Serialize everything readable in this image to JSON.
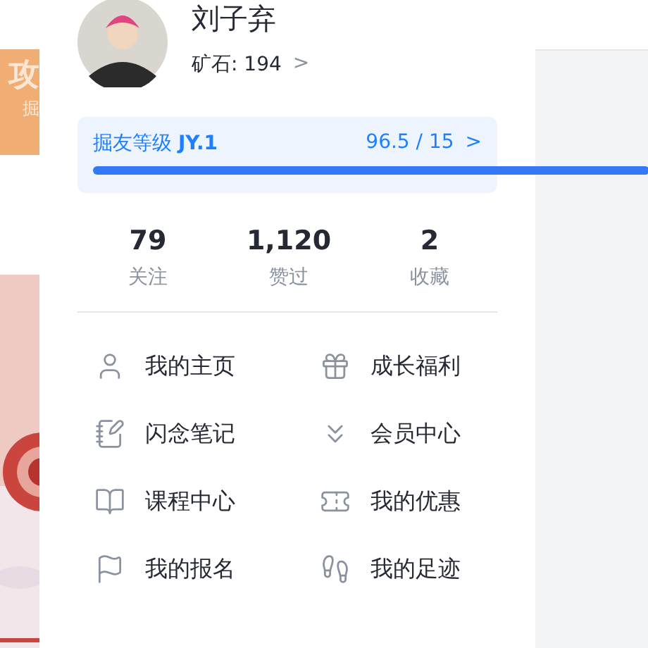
{
  "background": {
    "banner": {
      "title": "攻",
      "subtitle": "掘"
    }
  },
  "profile": {
    "name": "刘子弃",
    "ore": "矿石: 194",
    "ore_arrow": ">"
  },
  "level": {
    "label": "掘友等级",
    "badge": "JY.1",
    "score": "96.5 / 15",
    "arrow": ">"
  },
  "stats": [
    {
      "value": "79",
      "label": "关注"
    },
    {
      "value": "1,120",
      "label": "赞过"
    },
    {
      "value": "2",
      "label": "收藏"
    }
  ],
  "menu": [
    {
      "kind": "user",
      "label": "我的主页"
    },
    {
      "kind": "gift",
      "label": "成长福利"
    },
    {
      "kind": "notes",
      "label": "闪念笔记"
    },
    {
      "kind": "vip",
      "label": "会员中心"
    },
    {
      "kind": "course",
      "label": "课程中心"
    },
    {
      "kind": "coupon",
      "label": "我的优惠"
    },
    {
      "kind": "flag",
      "label": "我的报名"
    },
    {
      "kind": "footprint",
      "label": "我的足迹"
    }
  ]
}
